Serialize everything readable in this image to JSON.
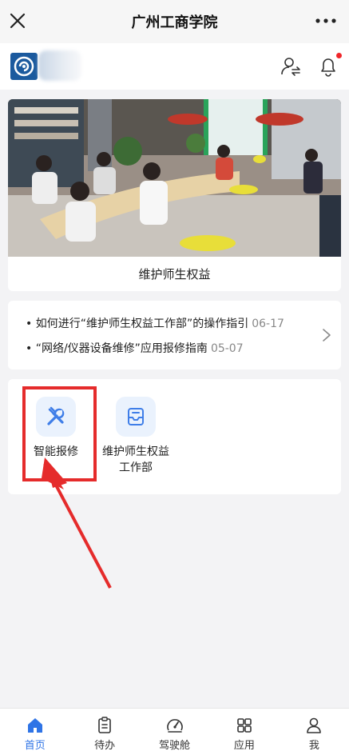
{
  "window": {
    "title": "广州工商学院"
  },
  "banner": {
    "caption": "维护师生权益"
  },
  "notices": [
    {
      "text": "• 如何进行“维护师生权益工作部”的操作指引",
      "date": "06-17"
    },
    {
      "text": "• “网络/仪器设备维修”应用报修指南",
      "date": "05-07"
    }
  ],
  "apps": [
    {
      "label": "智能报修",
      "icon": "wrench-screwdriver-icon"
    },
    {
      "label": "维护师生权益工作部",
      "icon": "mail-tray-icon"
    }
  ],
  "tabs": [
    {
      "label": "首页",
      "icon": "home-icon",
      "active": true
    },
    {
      "label": "待办",
      "icon": "clipboard-icon",
      "active": false
    },
    {
      "label": "驾驶舱",
      "icon": "gauge-icon",
      "active": false
    },
    {
      "label": "应用",
      "icon": "grid-icon",
      "active": false
    },
    {
      "label": "我",
      "icon": "user-icon",
      "active": false
    }
  ],
  "colors": {
    "accent": "#2f74e6",
    "highlight": "#e52b2b",
    "notification_dot": "#f0262a",
    "logo": "#1b5a9e"
  }
}
